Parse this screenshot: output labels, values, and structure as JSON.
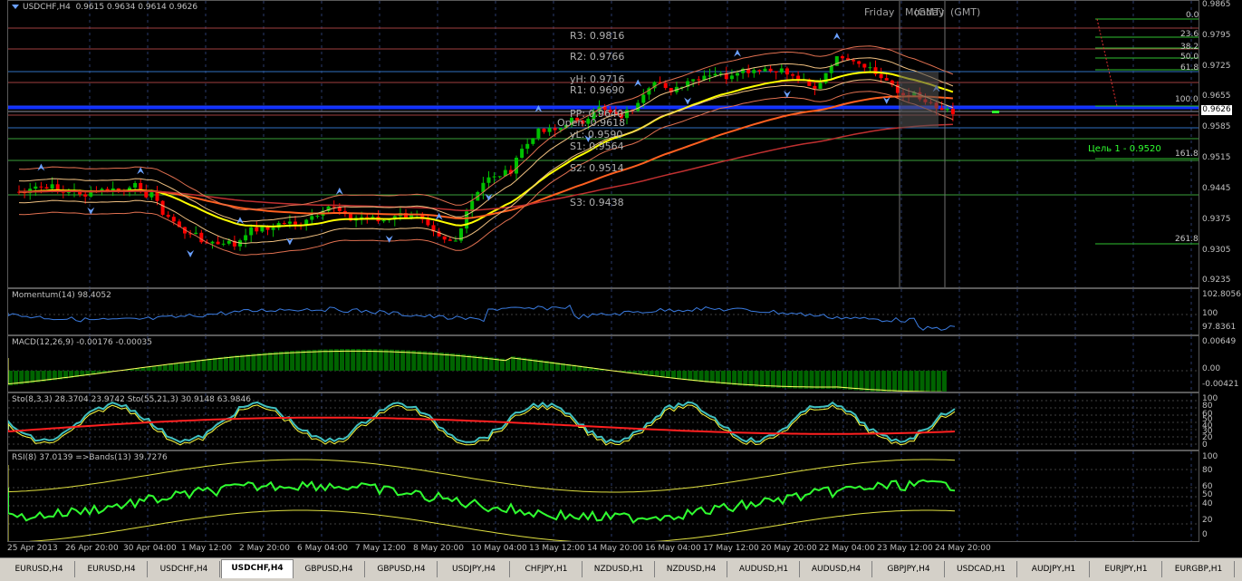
{
  "main_chart": {
    "symbol_label": "USDCHF,H4",
    "ohlc": "0.9615 0.9634 0.9614 0.9626",
    "session_labels": [
      "Friday",
      "Monday",
      "(GMT)",
      "(GMT)"
    ],
    "current_price": "0.9626",
    "price_scale": [
      "0.9865",
      "0.9795",
      "0.9725",
      "0.9655",
      "0.9585",
      "0.9515",
      "0.9445",
      "0.9375",
      "0.9305",
      "0.9235"
    ],
    "pivots": {
      "r3": "R3:  0.9816",
      "r2": "R2:  0.9766",
      "yh": "yH:  0.9716",
      "r1": "R1:  0.9690",
      "pp": "PP:  0.9640",
      "open": "Open:  0.9618",
      "yl": "yL:  0.9590",
      "s1": "S1:  0.9564",
      "s2": "S2:  0.9514",
      "s3": "S3:  0.9438"
    },
    "fib_levels": [
      "0.0",
      "23.6",
      "38.2",
      "50.0",
      "61.8",
      "100.0",
      "161.8",
      "261.8"
    ],
    "target_label": "Цель 1 - 0.9520"
  },
  "indicators": {
    "momentum": {
      "label": "Momentum(14) 98.4052",
      "scale": [
        "102.8056",
        "100",
        "97.8361"
      ]
    },
    "macd": {
      "label": "MACD(12,26,9) -0.00176 -0.00035",
      "scale": [
        "0.00649",
        "0.00",
        "-0.00421"
      ]
    },
    "stoch": {
      "label": "Sto(8,3,3) 28.3704 23.9742  Sto(55,21,3) 30.9148 63.9846",
      "scale": [
        "100",
        "80",
        "60",
        "50",
        "40",
        "30",
        "20",
        "0"
      ]
    },
    "rsi": {
      "label": "RSI(8) 37.0139  =>Bands(13) 39.7276",
      "scale": [
        "100",
        "80",
        "60",
        "50",
        "40",
        "20",
        "0"
      ]
    }
  },
  "time_axis": [
    "25 Apr 2013",
    "26 Apr 20:00",
    "30 Apr 04:00",
    "1 May 12:00",
    "2 May 20:00",
    "6 May 04:00",
    "7 May 12:00",
    "8 May 20:00",
    "10 May 04:00",
    "13 May 12:00",
    "14 May 20:00",
    "16 May 04:00",
    "17 May 12:00",
    "20 May 20:00",
    "22 May 04:00",
    "23 May 12:00",
    "24 May 20:00"
  ],
  "tabs": [
    "EURUSD,H4",
    "EURUSD,H4",
    "USDCHF,H4",
    "USDCHF,H4",
    "GBPUSD,H4",
    "GBPUSD,H4",
    "USDJPY,H4",
    "CHFJPY,H1",
    "NZDUSD,H1",
    "NZDUSD,H4",
    "AUDUSD,H1",
    "AUDUSD,H4",
    "GBPJPY,H4",
    "USDCAD,H1",
    "AUDJPY,H1",
    "EURJPY,H1",
    "EURGBP,H1"
  ],
  "active_tab_index": 3,
  "colors": {
    "bull": "#00c000",
    "bear": "#ff0000",
    "ma_fast": "#ffff00",
    "ma_slow": "#ff6020",
    "bands": "#e07050",
    "grid": "#2a3a6a",
    "momentum": "#3a7be0",
    "macd_hist": "#006400",
    "rsi": "#30ff30"
  }
}
